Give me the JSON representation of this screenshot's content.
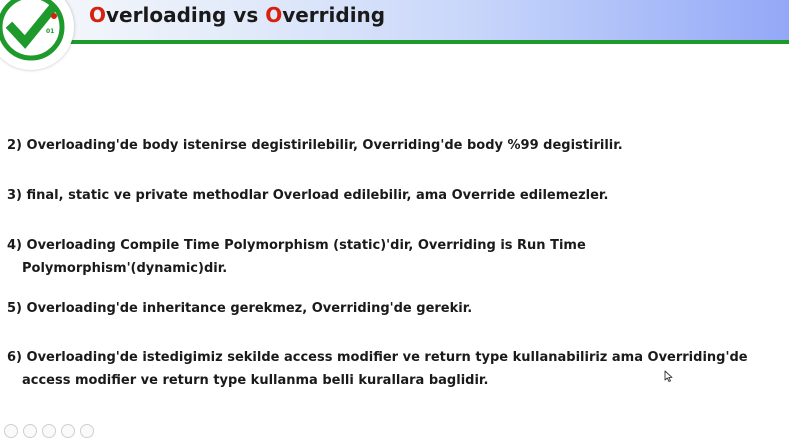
{
  "slide": {
    "logo": {
      "icon": "checkmark-badge-icon",
      "text": "01"
    },
    "title": {
      "part1_initial": "O",
      "part1_rest": "verloading",
      "vs": " vs ",
      "part2_initial": "O",
      "part2_rest": "verriding"
    },
    "items": [
      {
        "line1": "2) Overloading'de body istenirse degistirilebilir, Overriding'de body %99  degistirilir.",
        "line2": ""
      },
      {
        "line1": "3) final, static ve private methodlar Overload edilebilir, ama Override edilemezler.",
        "line2": ""
      },
      {
        "line1": "4) Overloading Compile Time Polymorphism (static)'dir, Overriding is Run Time",
        "line2": "Polymorphism'(dynamic)dir."
      },
      {
        "line1": "5) Overloading'de inheritance gerekmez, Overriding'de gerekir.",
        "line2": ""
      },
      {
        "line1": "6) Overloading'de istedigimiz sekilde access modifier ve return type kullanabiliriz ama Overriding'de",
        "line2": "access modifier ve return type kullanma belli kurallara baglidir."
      }
    ]
  },
  "colors": {
    "accent_red": "#d8200f",
    "green_rule": "#1e9a2c",
    "header_blue": "#93a8f7"
  },
  "cursor": {
    "icon": "mouse-pointer-icon"
  }
}
